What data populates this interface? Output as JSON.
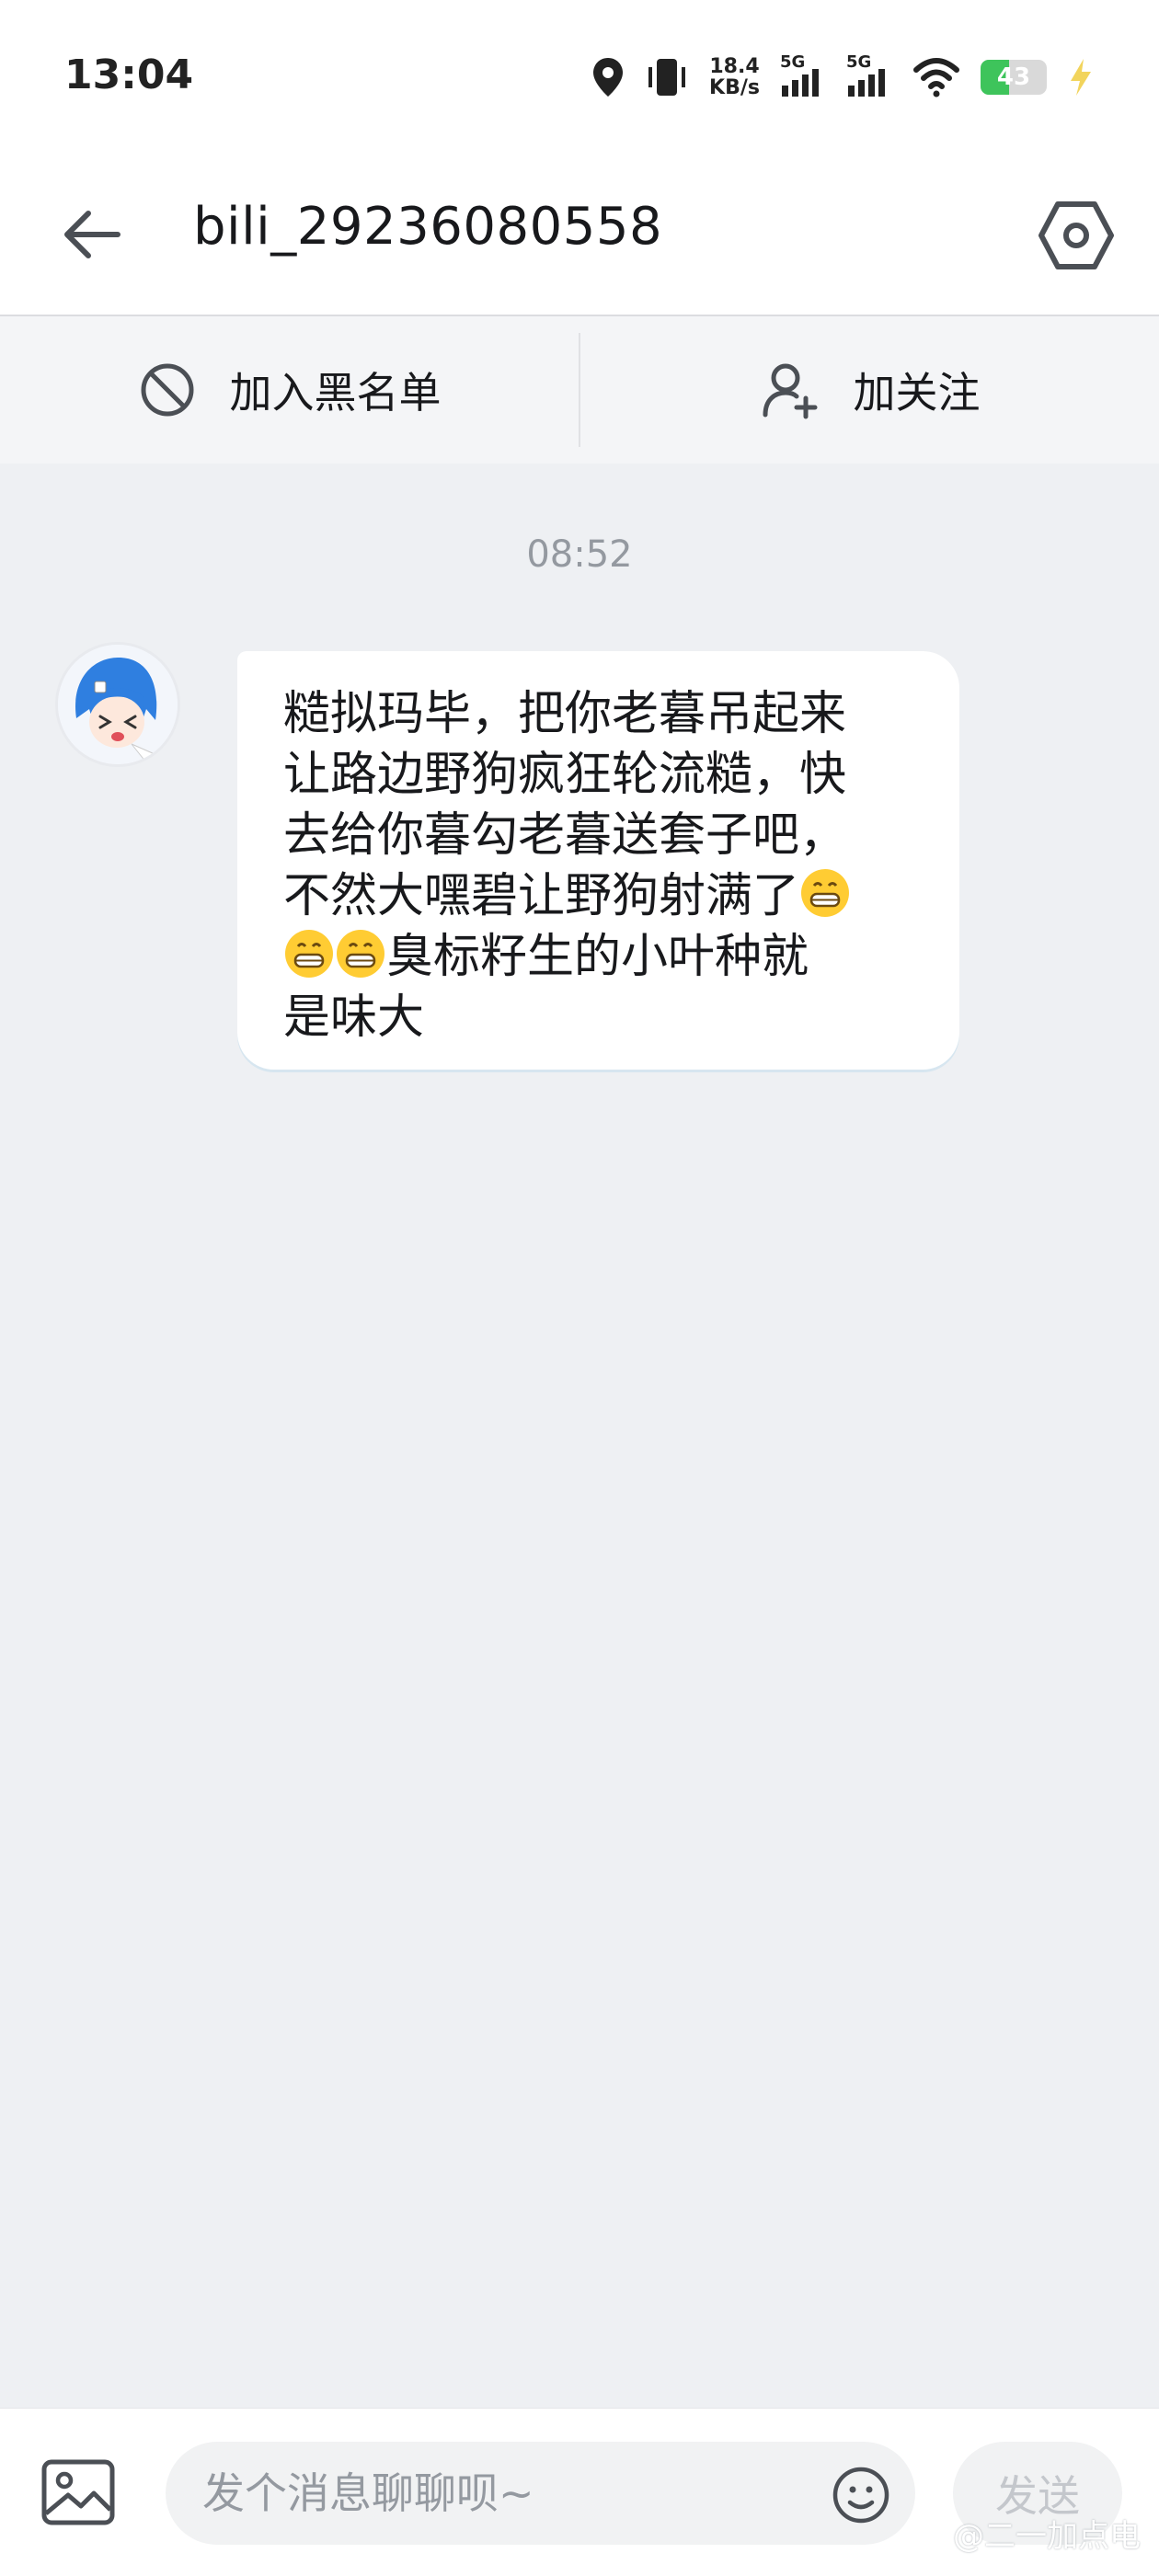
{
  "status_bar": {
    "time": "13:04",
    "net_speed_value": "18.4",
    "net_speed_unit": "KB/s",
    "signal_1_label": "5G",
    "signal_2_label": "5G",
    "battery_level": "43",
    "battery_percent": 43
  },
  "header": {
    "title": "bili_29236080558"
  },
  "actions": {
    "block_label": "加入黑名单",
    "follow_label": "加关注"
  },
  "conversation": {
    "timestamp": "08:52",
    "message": {
      "line1": "糙拟玛毕，把你老暮吊起来",
      "line2": "让路边野狗疯狂轮流糙，快",
      "line3": "去给你暮勾老暮送套子吧，",
      "line4": "不然大嘿碧让野狗射满了",
      "line5": "臭标籽生的小叶种就",
      "line6": "是味大",
      "emoji": "grinning-face"
    }
  },
  "input_bar": {
    "placeholder": "发个消息聊聊呗~",
    "send_label": "发送"
  },
  "watermark": "@二一加点电",
  "colors": {
    "background": "#eef0f3",
    "bubble": "#ffffff",
    "battery": "#3ec45b",
    "muted_text": "#9499a0"
  }
}
